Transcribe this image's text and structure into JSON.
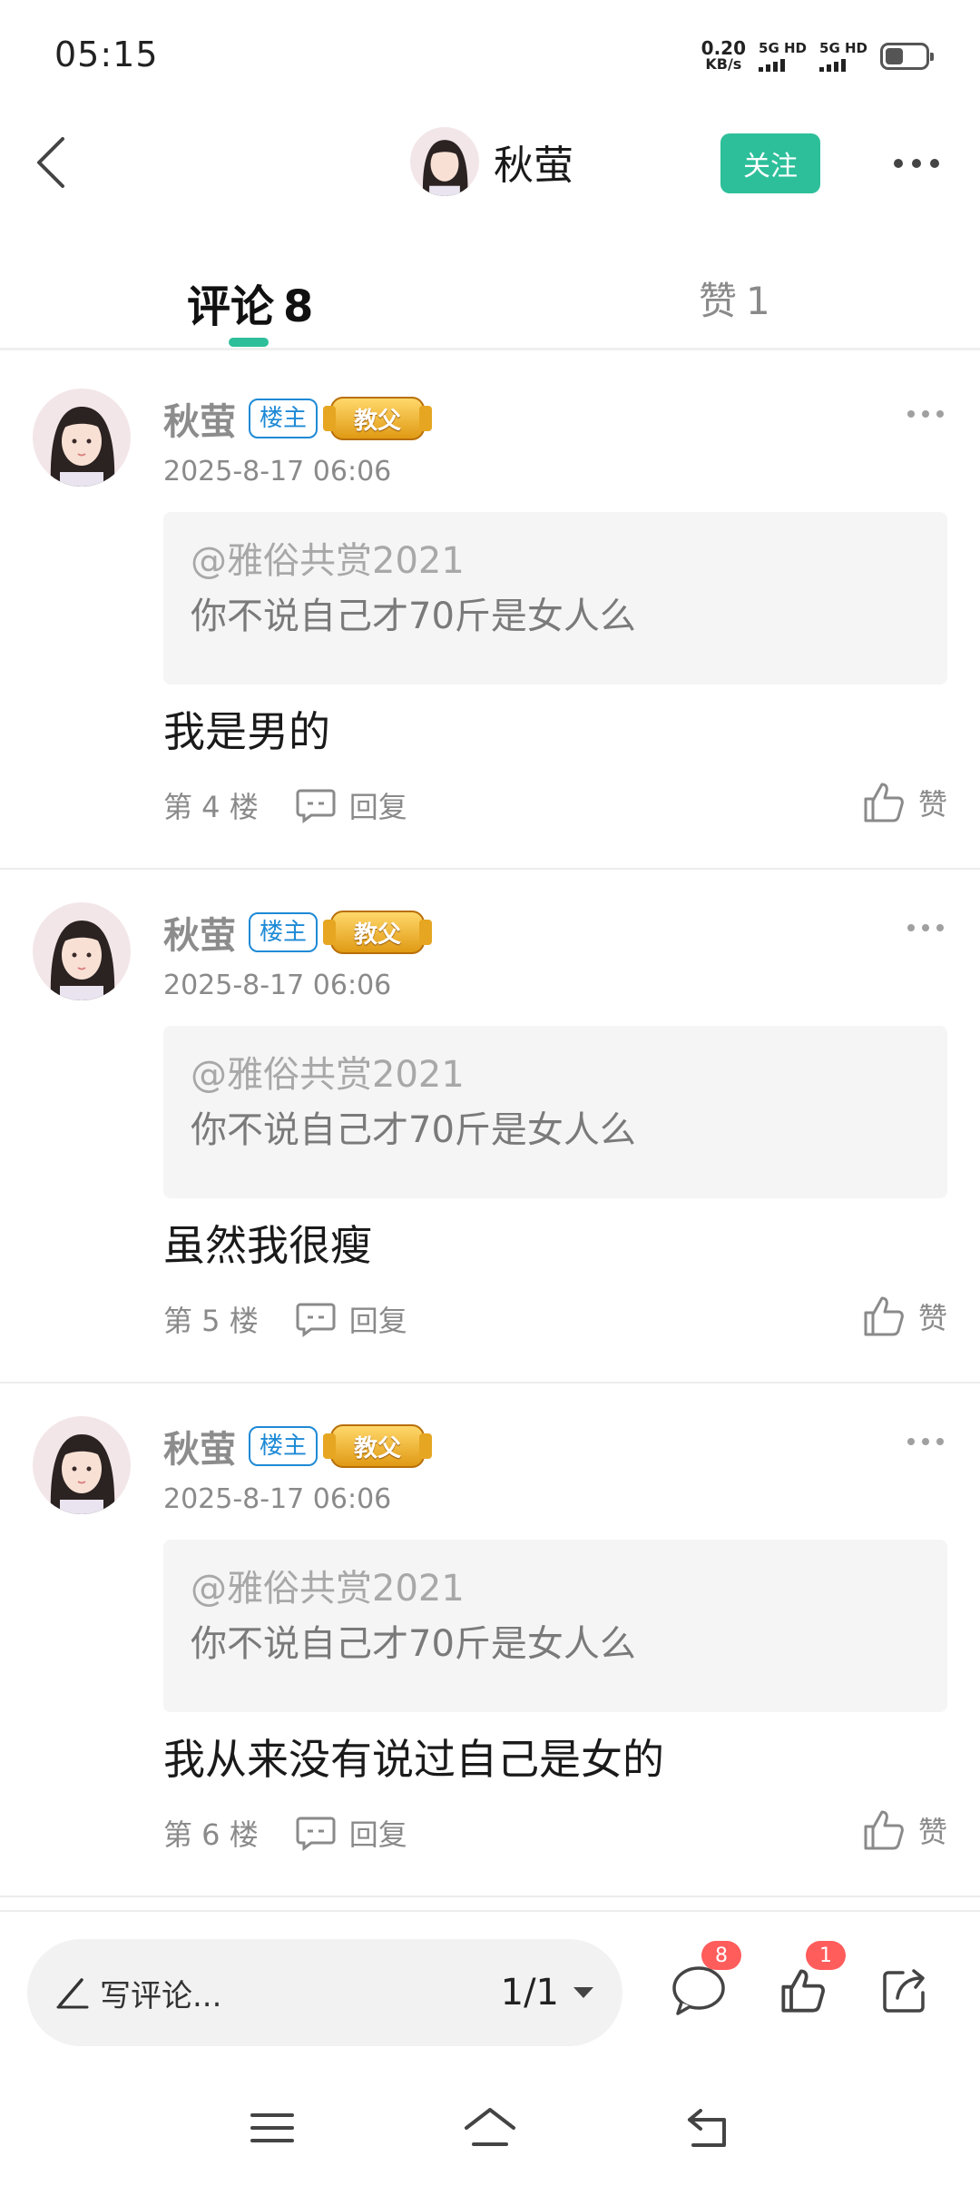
{
  "status_bar": {
    "time": "05:15",
    "net_speed_value": "0.20",
    "net_speed_unit": "KB/s",
    "sim1_label": "5G HD",
    "sim2_label": "5G HD",
    "battery_level": 0.45
  },
  "header": {
    "user_name": "秋萤",
    "follow_label": "关注"
  },
  "tabs": {
    "comments_label": "评论",
    "comments_count": "8",
    "likes_label": "赞",
    "likes_count": "1"
  },
  "comments": [
    {
      "name": "秋萤",
      "owner_badge": "楼主",
      "rank_badge": "教父",
      "time": "2025-8-17 06:06",
      "quote_user": "@雅俗共赏2021",
      "quote_text": "你不说自己才70斤是女人么",
      "text": "我是男的",
      "floor": "第 4 楼",
      "reply_label": "回复",
      "like_label": "赞"
    },
    {
      "name": "秋萤",
      "owner_badge": "楼主",
      "rank_badge": "教父",
      "time": "2025-8-17 06:06",
      "quote_user": "@雅俗共赏2021",
      "quote_text": "你不说自己才70斤是女人么",
      "text": "虽然我很瘦",
      "floor": "第 5 楼",
      "reply_label": "回复",
      "like_label": "赞"
    },
    {
      "name": "秋萤",
      "owner_badge": "楼主",
      "rank_badge": "教父",
      "time": "2025-8-17 06:06",
      "quote_user": "@雅俗共赏2021",
      "quote_text": "你不说自己才70斤是女人么",
      "text": "我从来没有说过自己是女的",
      "floor": "第 6 楼",
      "reply_label": "回复",
      "like_label": "赞"
    }
  ],
  "bottom_bar": {
    "input_placeholder": "写评论...",
    "page_indicator": "1/1",
    "comment_badge": "8",
    "like_badge": "1"
  },
  "colors": {
    "accent": "#2dbf9a",
    "owner_badge": "#1e8ad6",
    "badge_red": "#ff5c5c"
  }
}
